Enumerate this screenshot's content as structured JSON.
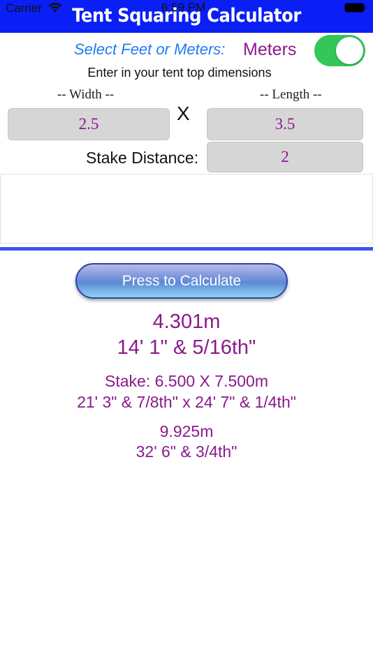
{
  "status_bar": {
    "carrier": "Carrier",
    "time": "6:59 PM"
  },
  "header": {
    "title": "Tent Squaring Calculator",
    "background_color": "#0a1ff5"
  },
  "units": {
    "label": "Select Feet or Meters:",
    "selected": "Meters",
    "toggle_on": true
  },
  "inputs": {
    "instructions": "Enter in your tent top dimensions",
    "width_label": "-- Width --",
    "length_label": "-- Length --",
    "width_value": "2.5",
    "length_value": "3.5",
    "separator": "X",
    "stake_label": "Stake Distance:",
    "stake_value": "2"
  },
  "calculate_button": {
    "label": "Press to Calculate"
  },
  "results": {
    "diagonal_metric": "4.301m",
    "diagonal_imperial": "14' 1\" & 5/16th\"",
    "stake_metric": "Stake: 6.500 X 7.500m",
    "stake_imperial": "21' 3\" & 7/8th\" x 24' 7\" & 1/4th\"",
    "stake_diagonal_metric": "9.925m",
    "stake_diagonal_imperial": "32' 6\" & 3/4th\""
  },
  "colors": {
    "accent_purple": "#8a1a8a",
    "label_blue": "#1e7cf2",
    "toggle_green": "#34c659"
  }
}
